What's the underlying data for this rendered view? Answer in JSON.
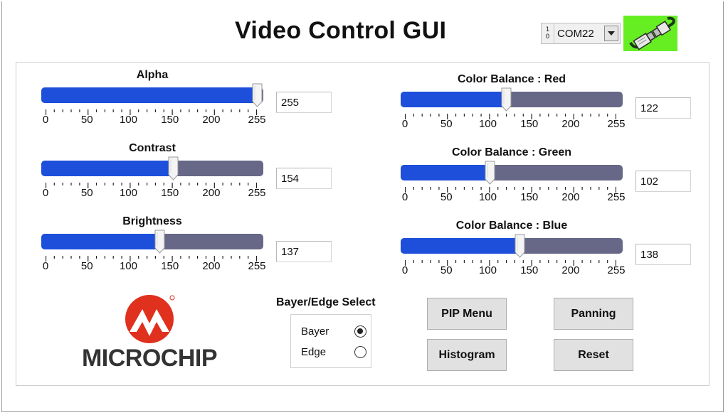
{
  "title": "Video Control GUI",
  "com_port": {
    "io_top": "1",
    "io_bottom": "0",
    "value": "COM22"
  },
  "sliders_left": [
    {
      "label": "Alpha",
      "value": 255
    },
    {
      "label": "Contrast",
      "value": 154
    },
    {
      "label": "Brightness",
      "value": 137
    }
  ],
  "sliders_right": [
    {
      "label": "Color Balance : Red",
      "value": 122
    },
    {
      "label": "Color Balance : Green",
      "value": 102
    },
    {
      "label": "Color Balance : Blue",
      "value": 138
    }
  ],
  "scale": {
    "min": 0,
    "max": 255,
    "labels": [
      "0",
      "50",
      "100",
      "150",
      "200",
      "255"
    ]
  },
  "logo_text": "MICROCHIP",
  "bayer_edge": {
    "title": "Bayer/Edge Select",
    "options": [
      {
        "label": "Bayer",
        "selected": true
      },
      {
        "label": "Edge",
        "selected": false
      }
    ]
  },
  "buttons": {
    "pip_menu": "PIP Menu",
    "panning": "Panning",
    "histogram": "Histogram",
    "reset": "Reset"
  },
  "colors": {
    "fill": "#1d4fdb",
    "track": "#676788",
    "connected": "#66ee22",
    "logo_red": "#e0301e"
  },
  "icons": {
    "connection": "connected-cable-icon"
  }
}
